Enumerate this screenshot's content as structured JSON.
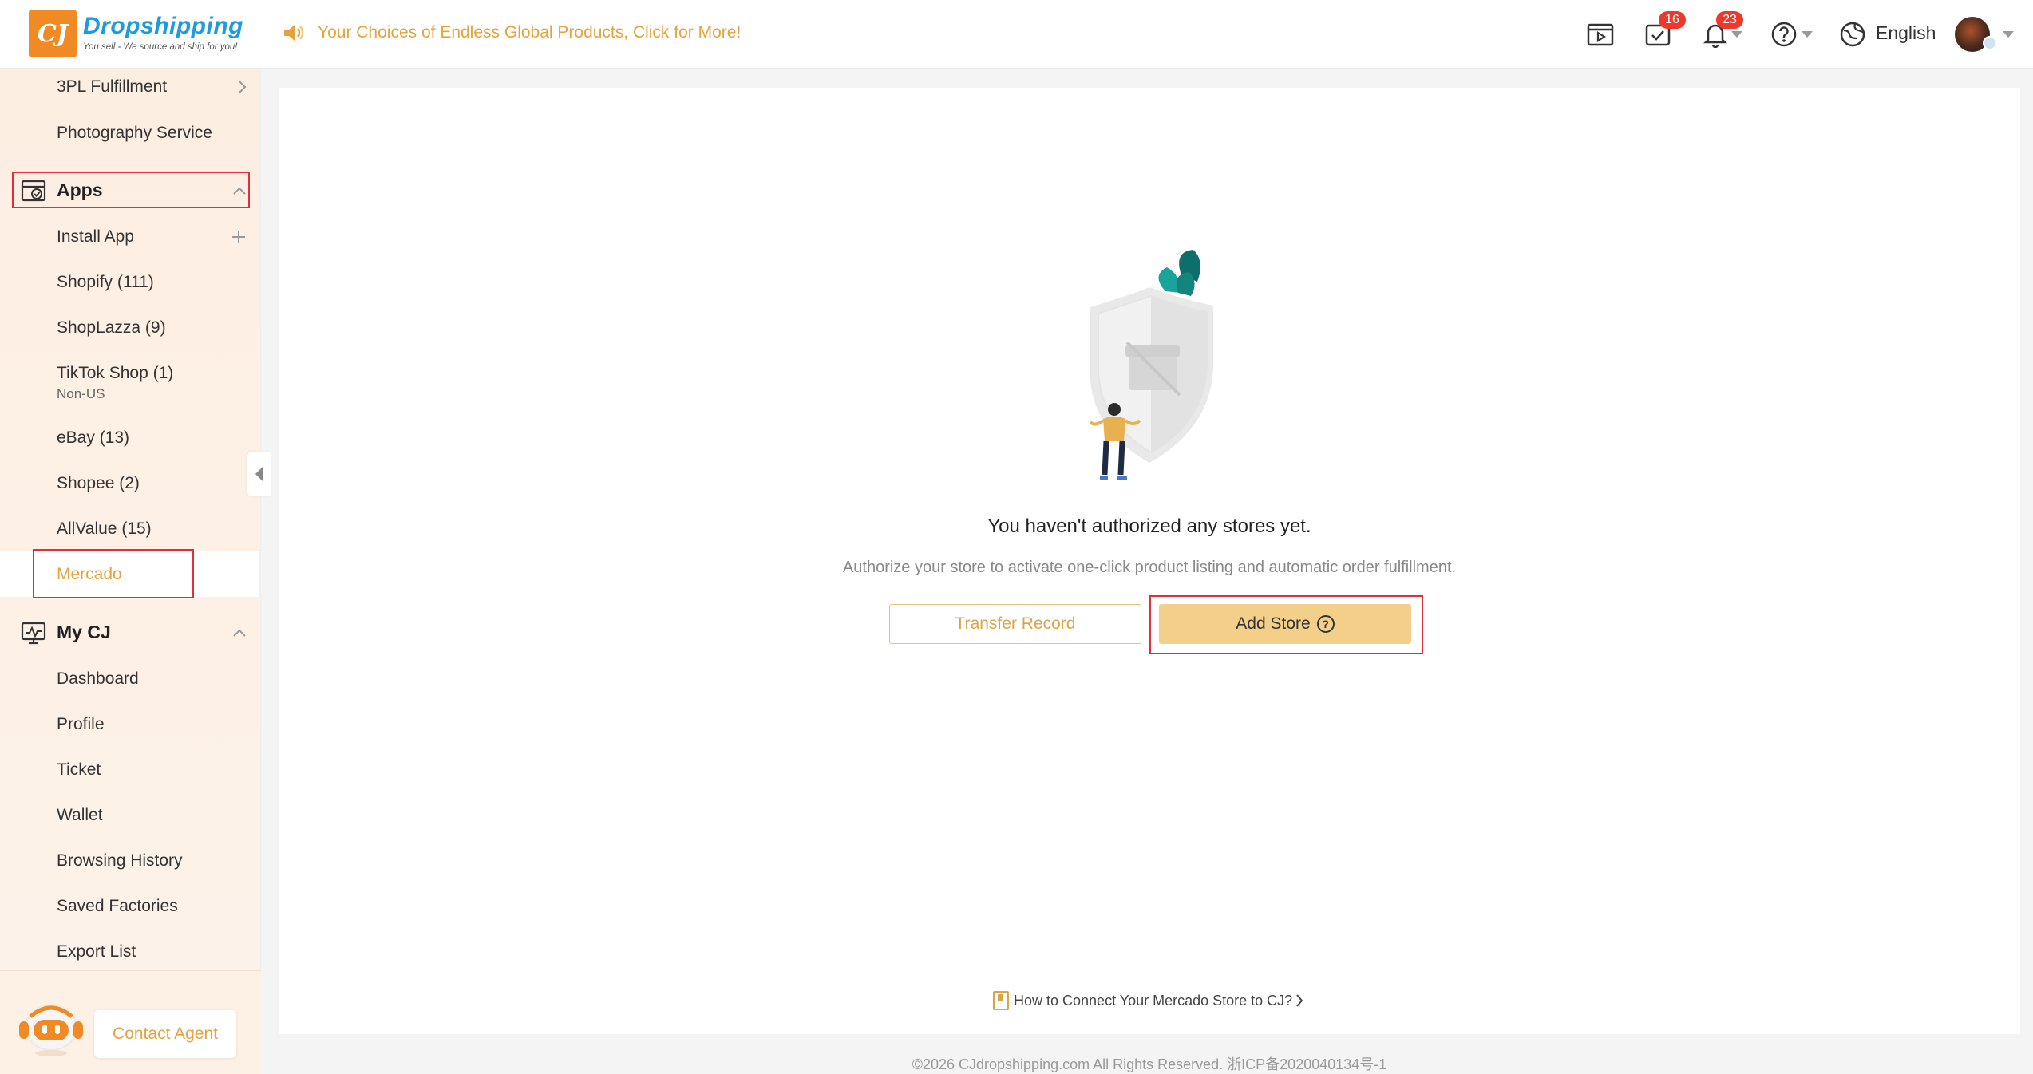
{
  "header": {
    "logo_name": "Dropshipping",
    "logo_tag": "You sell - We source and ship for you!",
    "logo_mark": "CJ",
    "announcement": "Your Choices of Endless Global Products, Click for More!",
    "tasks_badge": "16",
    "notifications_badge": "23",
    "language": "English"
  },
  "sidebar": {
    "top_items": [
      {
        "label": "3PL Fulfillment"
      },
      {
        "label": "Photography Service"
      }
    ],
    "apps_group": "Apps",
    "apps_items": [
      {
        "label": "Install App"
      },
      {
        "label": "Shopify (111)"
      },
      {
        "label": "ShopLazza (9)"
      },
      {
        "label": "TikTok Shop (1)",
        "sub": "Non-US"
      },
      {
        "label": "eBay (13)"
      },
      {
        "label": "Shopee (2)"
      },
      {
        "label": "AllValue (15)"
      },
      {
        "label": "Mercado"
      }
    ],
    "mycj_group": "My CJ",
    "mycj_items": [
      {
        "label": "Dashboard"
      },
      {
        "label": "Profile"
      },
      {
        "label": "Ticket"
      },
      {
        "label": "Wallet"
      },
      {
        "label": "Browsing History"
      },
      {
        "label": "Saved Factories"
      },
      {
        "label": "Export List"
      }
    ],
    "contact_agent": "Contact Agent"
  },
  "main": {
    "empty_title": "You haven't authorized any stores yet.",
    "empty_desc": "Authorize your store to activate one-click product listing and automatic order fulfillment.",
    "transfer_record": "Transfer Record",
    "add_store": "Add Store",
    "help_link": "How to Connect Your Mercado Store to CJ?",
    "footer": "©2026 CJdropshipping.com All Rights Reserved. 浙ICP备2020040134号-1"
  },
  "colors": {
    "accent": "#e6a23c",
    "add_store_bg": "#f3cf8a",
    "highlight": "#e0303a",
    "badge": "#f0382a",
    "logo_blue": "#1e9be0"
  }
}
